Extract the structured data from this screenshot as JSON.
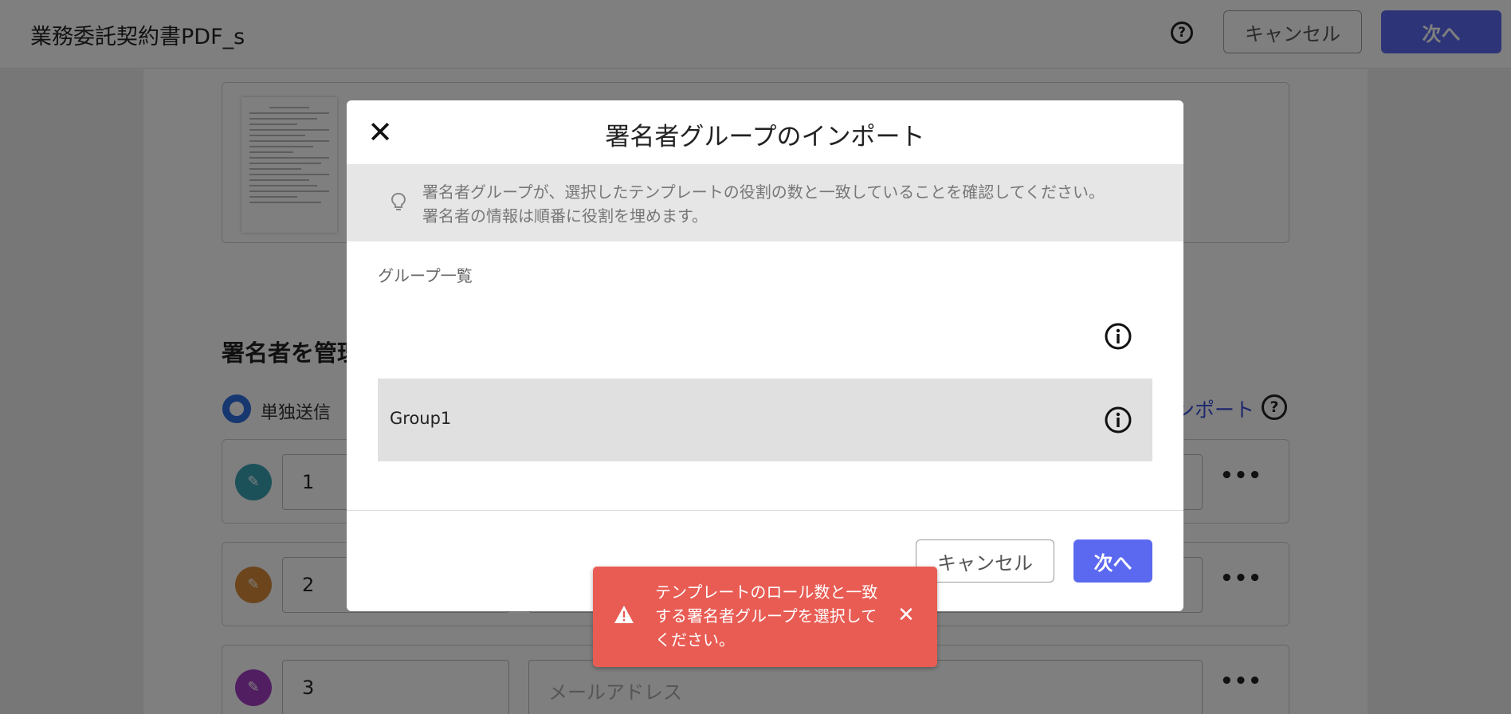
{
  "header": {
    "doc_title": "業務委託契約書PDF_s",
    "help_icon": "question-circle-icon",
    "cancel_label": "キャンセル",
    "next_label": "次へ"
  },
  "page": {
    "section_title": "署名者を管理",
    "radio_single_label": "単独送信",
    "import_link": "ンポート",
    "signers": [
      {
        "order": "1",
        "avatar_color": "#3aa3b5",
        "email_placeholder": ""
      },
      {
        "order": "2",
        "avatar_color": "#d88a3a",
        "email_placeholder": ""
      },
      {
        "order": "3",
        "avatar_color": "#a23fc2",
        "email_placeholder": "メールアドレス"
      }
    ],
    "more_label": "•••"
  },
  "modal": {
    "title": "署名者グループのインポート",
    "close_icon": "close-icon",
    "notice_line1": "署名者グループが、選択したテンプレートの役割の数と一致していることを確認してください。",
    "notice_line2": "署名者の情報は順番に役割を埋めます。",
    "group_list_label": "グループ一覧",
    "groups": [
      {
        "name": "",
        "selected": false
      },
      {
        "name": "Group1",
        "selected": true
      }
    ],
    "cancel_label": "キャンセル",
    "next_label": "次へ"
  },
  "toast": {
    "message": "テンプレートのロール数と一致する署名者グループを選択してください。",
    "icon": "warning-icon",
    "color": "#e85c54"
  },
  "colors": {
    "primary": "#5b69f0",
    "toast_error": "#e85c54"
  }
}
